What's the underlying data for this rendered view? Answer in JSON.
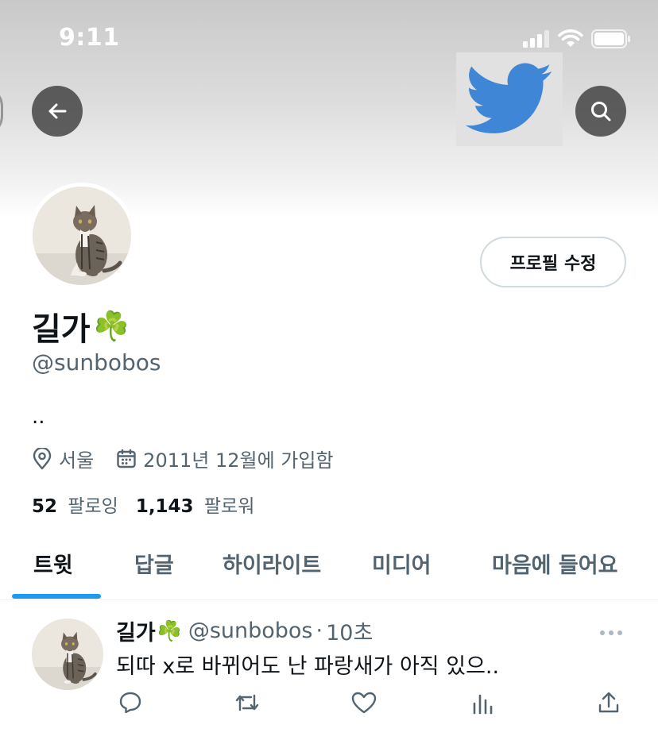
{
  "status_bar": {
    "time": "9:11"
  },
  "profile": {
    "display_name": "길가",
    "name_emoji": "☘️",
    "handle": "@sunbobos",
    "bio": "..",
    "location": "서울",
    "joined": "2011년 12월에 가입함",
    "following_count": "52",
    "following_label": "팔로잉",
    "followers_count": "1,143",
    "followers_label": "팔로워",
    "edit_button_label": "프로필 수정"
  },
  "tabs": [
    {
      "label": "트윗",
      "active": true
    },
    {
      "label": "답글",
      "active": false
    },
    {
      "label": "하이라이트",
      "active": false
    },
    {
      "label": "미디어",
      "active": false
    },
    {
      "label": "마음에 들어요",
      "active": false
    }
  ],
  "tweet": {
    "author": "길가",
    "author_emoji": "☘️",
    "handle": "@sunbobos",
    "separator": "·",
    "time": "10초",
    "text": "되따 x로 바뀌어도 난 파랑새가 아직 있으..",
    "actions": [
      "reply-icon",
      "retweet-icon",
      "like-icon",
      "views-icon",
      "share-icon"
    ]
  },
  "icons": {
    "back": "arrow-left-icon",
    "search": "search-icon",
    "bird": "twitter-bird-logo",
    "location": "location-pin-icon",
    "calendar": "calendar-icon",
    "more": "more-dots-icon"
  },
  "colors": {
    "accent": "#1d9bf0",
    "bird": "#3f86d6",
    "secondary_text": "#536471",
    "primary_text": "#0f1419"
  }
}
